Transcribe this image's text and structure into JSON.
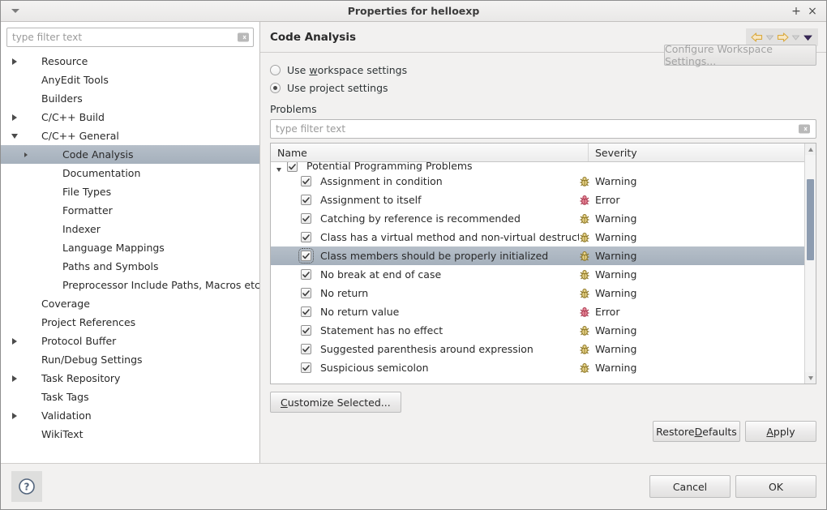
{
  "window": {
    "title": "Properties for helloexp",
    "menu_icon": "chevron-down-icon",
    "maximize_label": "+",
    "close_label": "×"
  },
  "sidebar": {
    "filter": {
      "placeholder": "type filter text",
      "value": "",
      "clear_icon": "clear-field-icon"
    },
    "items": [
      {
        "label": "Resource",
        "level": 0,
        "expander": "collapsed",
        "selected": false
      },
      {
        "label": "AnyEdit Tools",
        "level": 0,
        "expander": "none",
        "selected": false
      },
      {
        "label": "Builders",
        "level": 0,
        "expander": "none",
        "selected": false
      },
      {
        "label": "C/C++ Build",
        "level": 0,
        "expander": "collapsed",
        "selected": false
      },
      {
        "label": "C/C++ General",
        "level": 0,
        "expander": "expanded",
        "selected": false
      },
      {
        "label": "Code Analysis",
        "level": 1,
        "expander": "collapsed-small",
        "selected": true
      },
      {
        "label": "Documentation",
        "level": 1,
        "expander": "none",
        "selected": false
      },
      {
        "label": "File Types",
        "level": 1,
        "expander": "none",
        "selected": false
      },
      {
        "label": "Formatter",
        "level": 1,
        "expander": "none",
        "selected": false
      },
      {
        "label": "Indexer",
        "level": 1,
        "expander": "none",
        "selected": false
      },
      {
        "label": "Language Mappings",
        "level": 1,
        "expander": "none",
        "selected": false
      },
      {
        "label": "Paths and Symbols",
        "level": 1,
        "expander": "none",
        "selected": false
      },
      {
        "label": "Preprocessor Include Paths, Macros etc.",
        "level": 1,
        "expander": "none",
        "selected": false
      },
      {
        "label": "Coverage",
        "level": 0,
        "expander": "none",
        "selected": false
      },
      {
        "label": "Project References",
        "level": 0,
        "expander": "none",
        "selected": false
      },
      {
        "label": "Protocol Buffer",
        "level": 0,
        "expander": "collapsed",
        "selected": false
      },
      {
        "label": "Run/Debug Settings",
        "level": 0,
        "expander": "none",
        "selected": false
      },
      {
        "label": "Task Repository",
        "level": 0,
        "expander": "collapsed",
        "selected": false
      },
      {
        "label": "Task Tags",
        "level": 0,
        "expander": "none",
        "selected": false
      },
      {
        "label": "Validation",
        "level": 0,
        "expander": "collapsed",
        "selected": false
      },
      {
        "label": "WikiText",
        "level": 0,
        "expander": "none",
        "selected": false
      }
    ]
  },
  "page": {
    "title": "Code Analysis",
    "nav": {
      "back_icon": "back-arrow-icon",
      "back_menu_icon": "chevron-down-icon",
      "forward_icon": "forward-arrow-icon",
      "forward_menu_icon": "chevron-down-icon",
      "view_menu_icon": "chevron-down-icon"
    },
    "radio_workspace": {
      "label_pre": "Use ",
      "label_mnemonic": "w",
      "label_post": "orkspace settings",
      "checked": false
    },
    "radio_project": {
      "label_pre": "Use pro",
      "label_mnemonic": "j",
      "label_post": "ect settings",
      "checked": true
    },
    "configure_workspace_button": "Configure Workspace Settings...",
    "problems_label": "Problems",
    "problems_filter": {
      "placeholder": "type filter text",
      "value": "",
      "clear_icon": "clear-field-icon"
    },
    "table": {
      "columns": [
        "Name",
        "Severity"
      ],
      "group_row": {
        "label": "Potential Programming Problems",
        "checked": true,
        "expanded": true
      },
      "rows": [
        {
          "name": "Assignment in condition",
          "severity": "Warning",
          "checked": true,
          "selected": false
        },
        {
          "name": "Assignment to itself",
          "severity": "Error",
          "checked": true,
          "selected": false
        },
        {
          "name": "Catching by reference is recommended",
          "severity": "Warning",
          "checked": true,
          "selected": false
        },
        {
          "name": "Class has a virtual method and non-virtual destructor",
          "severity": "Warning",
          "checked": true,
          "selected": false
        },
        {
          "name": "Class members should be properly initialized",
          "severity": "Warning",
          "checked": true,
          "selected": true
        },
        {
          "name": "No break at end of case",
          "severity": "Warning",
          "checked": true,
          "selected": false
        },
        {
          "name": "No return",
          "severity": "Warning",
          "checked": true,
          "selected": false
        },
        {
          "name": "No return value",
          "severity": "Error",
          "checked": true,
          "selected": false
        },
        {
          "name": "Statement has no effect",
          "severity": "Warning",
          "checked": true,
          "selected": false
        },
        {
          "name": "Suggested parenthesis around expression",
          "severity": "Warning",
          "checked": true,
          "selected": false
        },
        {
          "name": "Suspicious semicolon",
          "severity": "Warning",
          "checked": true,
          "selected": false
        }
      ]
    },
    "customize_button": {
      "mnemonic": "C",
      "rest": "ustomize Selected..."
    },
    "restore_defaults_button": {
      "pre": "Restore ",
      "mnemonic": "D",
      "post": "efaults"
    },
    "apply_button": {
      "pre": "",
      "mnemonic": "A",
      "post": "pply"
    }
  },
  "footer": {
    "help_icon": "help-question-icon",
    "cancel_label": "Cancel",
    "ok_label": "OK"
  },
  "colors": {
    "selection": "#a5b0bc",
    "warning": "#c8a430",
    "error": "#cc4455",
    "nav_arrow": "#e8c98a",
    "window_bg": "#f2f1f0"
  }
}
